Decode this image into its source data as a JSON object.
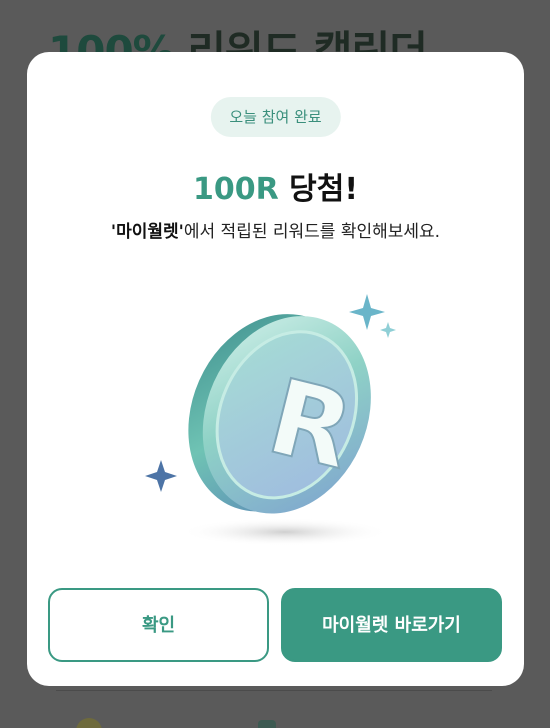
{
  "background": {
    "title_prefix": "100%",
    "title_rest": "리워드 캘린더"
  },
  "modal": {
    "badge": "오늘 참여 완료",
    "headline_amount": "100R",
    "headline_rest": "당첨!",
    "subtitle_brand": "'마이월렛'",
    "subtitle_rest": "에서 적립된 리워드를 확인해보세요.",
    "coin_letter": "R",
    "coin_icon": "reward-coin-icon",
    "sparkle_icon": "sparkle-icon",
    "confirm_label": "확인",
    "go_wallet_label": "마이월렛 바로가기"
  },
  "colors": {
    "accent": "#3a9983",
    "badge_bg": "#e7f3ef",
    "dim_overlay": "#5a5a5a"
  }
}
